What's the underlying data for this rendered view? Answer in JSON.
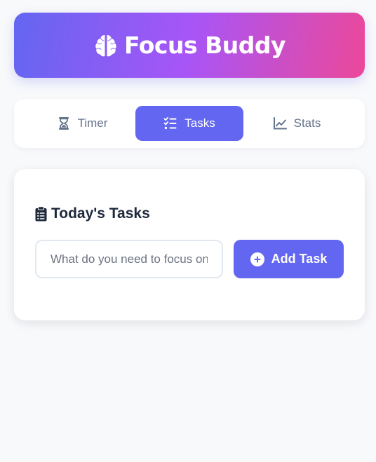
{
  "header": {
    "title": "Focus Buddy",
    "icon": "brain-icon"
  },
  "tabs": [
    {
      "label": "Timer",
      "icon": "hourglass-icon",
      "active": false
    },
    {
      "label": "Tasks",
      "icon": "task-list-icon",
      "active": true
    },
    {
      "label": "Stats",
      "icon": "chart-line-icon",
      "active": false
    }
  ],
  "tasks_panel": {
    "title": "Today's Tasks",
    "title_icon": "clipboard-list-icon",
    "input_value": "",
    "input_placeholder": "What do you need to focus on?",
    "add_button_label": "Add Task",
    "add_button_icon": "plus-circle-icon"
  },
  "colors": {
    "accent": "#6366f1",
    "gradient_start": "#6366f1",
    "gradient_mid": "#a855f7",
    "gradient_end": "#ec4899",
    "background": "#f8f9fb",
    "text_dark": "#1e293b",
    "text_muted": "#64748b"
  }
}
